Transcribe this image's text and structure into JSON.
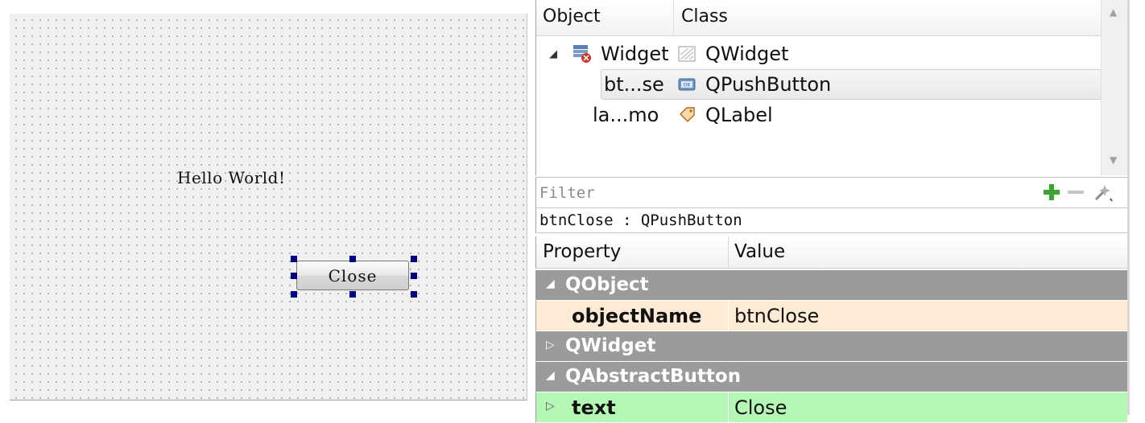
{
  "form": {
    "label_text": "Hello World!",
    "button_text": "Close"
  },
  "object_inspector": {
    "col_object": "Object",
    "col_class": "Class",
    "rows": [
      {
        "name": "Widget",
        "class": "QWidget",
        "icon": "widget-icon",
        "class_icon": "qwidget-class-icon"
      },
      {
        "name": "bt...se",
        "class": "QPushButton",
        "icon": "",
        "class_icon": "pushbutton-class-icon"
      },
      {
        "name": "la...mo",
        "class": "QLabel",
        "icon": "",
        "class_icon": "label-class-icon"
      }
    ]
  },
  "property_editor": {
    "filter_placeholder": "Filter",
    "object_class": "btnClose : QPushButton",
    "col_property": "Property",
    "col_value": "Value",
    "groups": [
      {
        "name": "QObject",
        "expanded": true
      },
      {
        "name": "QWidget",
        "expanded": false
      },
      {
        "name": "QAbstractButton",
        "expanded": true
      }
    ],
    "props": [
      {
        "name": "objectName",
        "value": "btnClose"
      },
      {
        "name": "text",
        "value": "Close"
      }
    ]
  },
  "colors": {
    "group_bg": "#9b9b9b",
    "objectname_row_bg": "#feebd6",
    "text_row_bg": "#b5f7b5",
    "selection_handle": "#000080"
  }
}
